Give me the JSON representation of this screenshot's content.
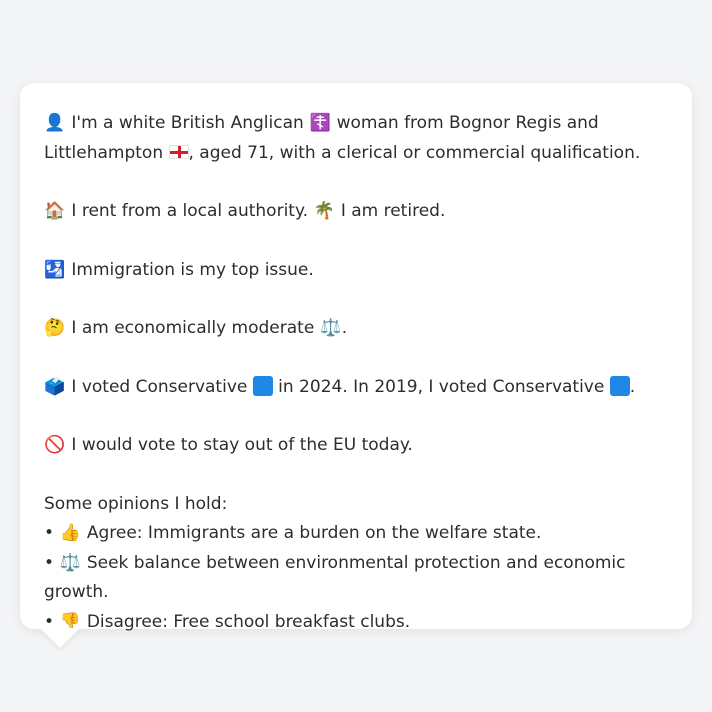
{
  "profile": {
    "line1_a": "I'm a white British Anglican",
    "line1_b": "woman from Bognor Regis and Littlehampton",
    "line1_c": ", aged 71, with a clerical or commercial qualification.",
    "housing": "I rent from a local authority.",
    "work": "I am retired.",
    "issue": "Immigration is my top issue.",
    "economic": "I am economically moderate",
    "economic_end": ".",
    "vote_a": "I voted Conservative",
    "vote_b": "in 2024. In 2019, I voted Conservative",
    "vote_end": ".",
    "eu": "I would vote to stay out of the EU today."
  },
  "opinions": {
    "title": "Some opinions I hold:",
    "items": [
      {
        "bullet": "•",
        "icon": "👍",
        "text": "Agree: Immigrants are a burden on the welfare state."
      },
      {
        "bullet": "•",
        "icon": "⚖️",
        "text": "Seek balance between environmental protection and economic growth."
      },
      {
        "bullet": "•",
        "icon": "👎",
        "text": "Disagree: Free school breakfast clubs."
      }
    ]
  },
  "icons": {
    "person": "👤",
    "cross": "☦️",
    "house": "🏠",
    "palm": "🌴",
    "passport": "🛂",
    "thinking": "🤔",
    "scales": "⚖️",
    "ballot": "🗳️",
    "no_entry": "🚫"
  },
  "colors": {
    "background": "#f3f4f6",
    "card": "#ffffff",
    "text": "#2d2d2d",
    "conservative": "#1f87e5"
  }
}
